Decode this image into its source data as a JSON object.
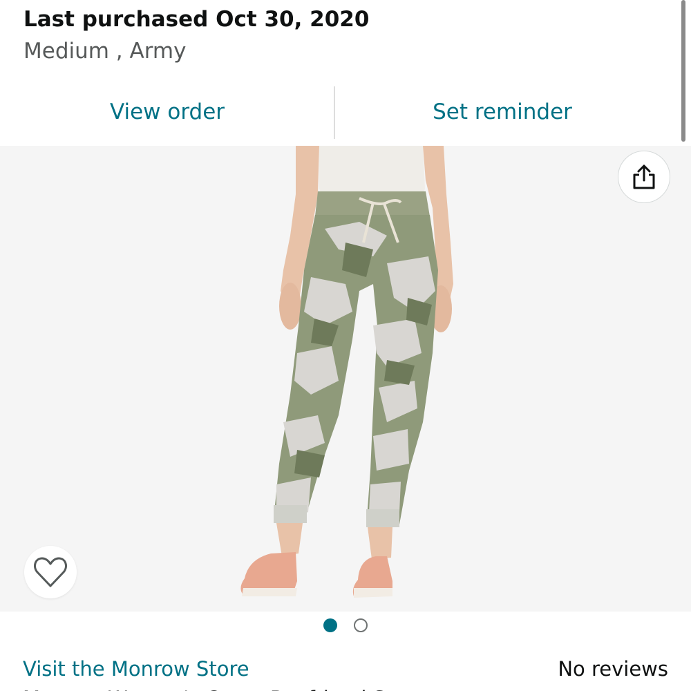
{
  "purchase": {
    "title": "Last purchased Oct 30, 2020",
    "variant": "Medium , Army"
  },
  "actions": {
    "view_order": "View order",
    "set_reminder": "Set reminder"
  },
  "image": {
    "share_icon": "share-icon",
    "wishlist_icon": "heart-icon",
    "dots": {
      "total": 2,
      "active_index": 0
    },
    "colors": {
      "background": "#f5f5f5",
      "camo_base": "#8f9a7a",
      "camo_light": "#d8d6d2",
      "camo_dark": "#6e7a5a",
      "skin": "#e8c2a8",
      "shoe": "#e8a890"
    }
  },
  "store": {
    "link": "Visit the Monrow Store",
    "reviews": "No reviews"
  },
  "product_title_peek": "Monrow Women's Camo Boyfriend Sweatpants"
}
